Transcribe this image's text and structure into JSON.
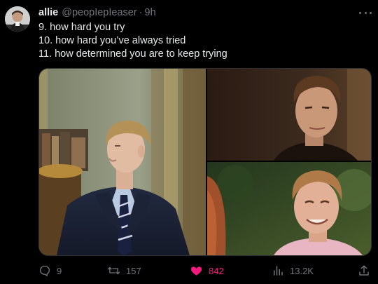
{
  "author": {
    "display_name": "allie",
    "handle": "@peopIepIeaser",
    "separator": "·",
    "time": "9h"
  },
  "tweet_lines": [
    "9. how hard you try",
    "10. how hard you’ve always tried",
    "11. how determined you are to keep trying"
  ],
  "media": {
    "count": 3,
    "tiles": [
      "man-in-navy-suit-turned-right",
      "man-face-closeup-dark-background",
      "man-smiling-outdoors-pink-shirt"
    ]
  },
  "actions": {
    "replies": "9",
    "retweets": "157",
    "likes": "842",
    "views": "13.2K",
    "like_active": true,
    "like_color": "#f91880"
  },
  "colors": {
    "background": "#000000",
    "text_primary": "#e7e9ea",
    "text_secondary": "#71767b",
    "like_pink": "#f91880"
  },
  "icons": [
    "more-icon",
    "reply-icon",
    "retweet-icon",
    "heart-icon",
    "views-icon",
    "share-icon"
  ]
}
